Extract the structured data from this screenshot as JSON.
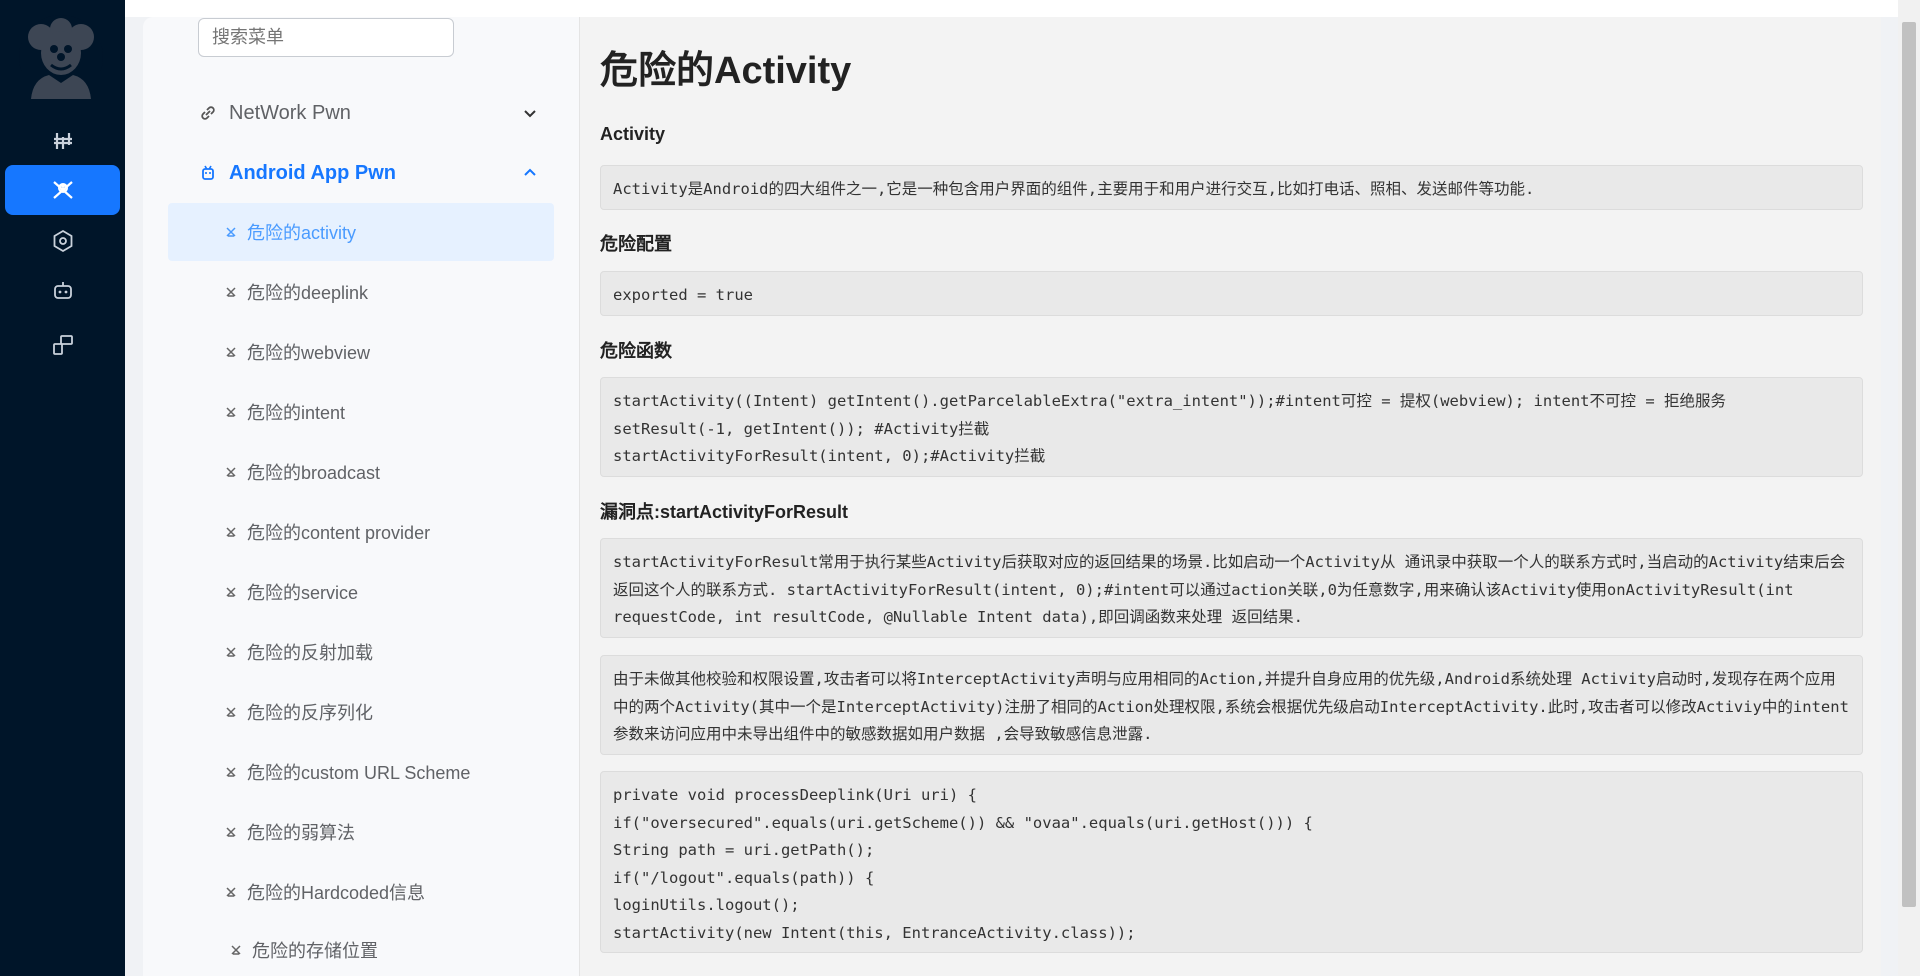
{
  "search": {
    "placeholder": "搜索菜单"
  },
  "groups": {
    "network": {
      "label": "NetWork Pwn",
      "icon": "link-icon"
    },
    "android": {
      "label": "Android App Pwn",
      "icon": "android-icon"
    }
  },
  "menu": [
    "危险的activity",
    "危险的deeplink",
    "危险的webview",
    "危险的intent",
    "危险的broadcast",
    "危险的content provider",
    "危险的service",
    "危险的反射加载",
    "危险的反序列化",
    "危险的custom URL Scheme",
    "危险的弱算法",
    "危险的Hardcoded信息",
    "危险的存储位置"
  ],
  "page": {
    "title": "危险的Activity",
    "h_activity": "Activity",
    "activity_desc": "Activity是Android的四大组件之一,它是一种包含用户界面的组件,主要用于和用户进行交互,比如打电话、照相、发送邮件等功能.",
    "h_config": "危险配置",
    "config": "exported = true",
    "h_funcs": "危险函数",
    "funcs": "startActivity((Intent) getIntent().getParcelableExtra(\"extra_intent\"));#intent可控 = 提权(webview); intent不可控 = 拒绝服务\nsetResult(-1, getIntent()); #Activity拦截\nstartActivityForResult(intent, 0);#Activity拦截",
    "h_vuln": "漏洞点:startActivityForResult",
    "vuln_desc": "startActivityForResult常用于执行某些Activity后获取对应的返回结果的场景.比如启动一个Activity从 通讯录中获取一个人的联系方式时,当启动的Activity结束后会返回这个人的联系方式. startActivityForResult(intent, 0);#intent可以通过action关联,0为任意数字,用来确认该Activity使用onActivityResult(int requestCode, int resultCode, @Nullable Intent data),即回调函数来处理 返回结果.",
    "attack_desc": "由于未做其他校验和权限设置,攻击者可以将InterceptActivity声明与应用相同的Action,并提升自身应用的优先级,Android系统处理 Activity启动时,发现存在两个应用中的两个Activity(其中一个是InterceptActivity)注册了相同的Action处理权限,系统会根据优先级启动InterceptActivity.此时,攻击者可以修改Activiy中的intent参数来访问应用中未导出组件中的敏感数据如用户数据 ,会导致敏感信息泄露.",
    "code": "private void processDeeplink(Uri uri) {\nif(\"oversecured\".equals(uri.getScheme()) && \"ovaa\".equals(uri.getHost())) {\nString path = uri.getPath();\nif(\"/logout\".equals(path)) {\nloginUtils.logout();\nstartActivity(new Intent(this, EntranceActivity.class));"
  }
}
